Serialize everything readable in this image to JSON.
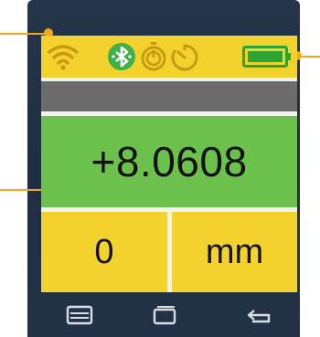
{
  "colors": {
    "accent_yellow": "#f4d22e",
    "value_green": "#6cc14c",
    "band_gray": "#6c6c6c",
    "device_bezel": "#223246",
    "callout_orange": "#f2a81d",
    "icon_dark_yellow": "#c79a12",
    "battery_green": "#2aa535"
  },
  "status_bar": {
    "icons": [
      "wifi-icon",
      "bluetooth-icon",
      "power-icon",
      "timer-icon",
      "battery-icon"
    ]
  },
  "reading": {
    "value": "+8.0608"
  },
  "bottom": {
    "left_value": "0",
    "unit": "mm"
  },
  "navbar": {
    "buttons": [
      "menu-icon",
      "home-icon",
      "back-icon"
    ]
  }
}
